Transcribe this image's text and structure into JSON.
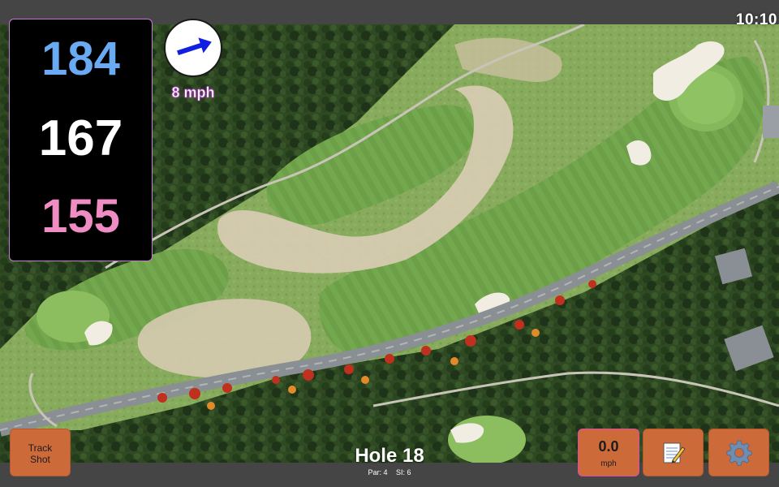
{
  "status_bar": {
    "clock": "10:10"
  },
  "distances": {
    "back": "184",
    "middle": "167",
    "front": "155",
    "back_color": "#6aaaf2",
    "middle_color": "#ffffff",
    "front_color": "#f08cc4"
  },
  "wind": {
    "speed_label": "8 mph",
    "arrow_icon": "arrow-right-icon",
    "arrow_color": "#1020e0"
  },
  "hole": {
    "title": "Hole 18",
    "par_label": "Par: 4",
    "si_label": "SI: 6"
  },
  "buttons": {
    "track_shot": {
      "line1": "Track",
      "line2": "Shot"
    },
    "speed": {
      "value": "0.0",
      "unit": "mph"
    },
    "notes_icon": "notepad-pencil-icon",
    "settings_icon": "gear-icon",
    "button_color": "#cc6a3a"
  },
  "map": {
    "type": "satellite-golf-hole"
  }
}
